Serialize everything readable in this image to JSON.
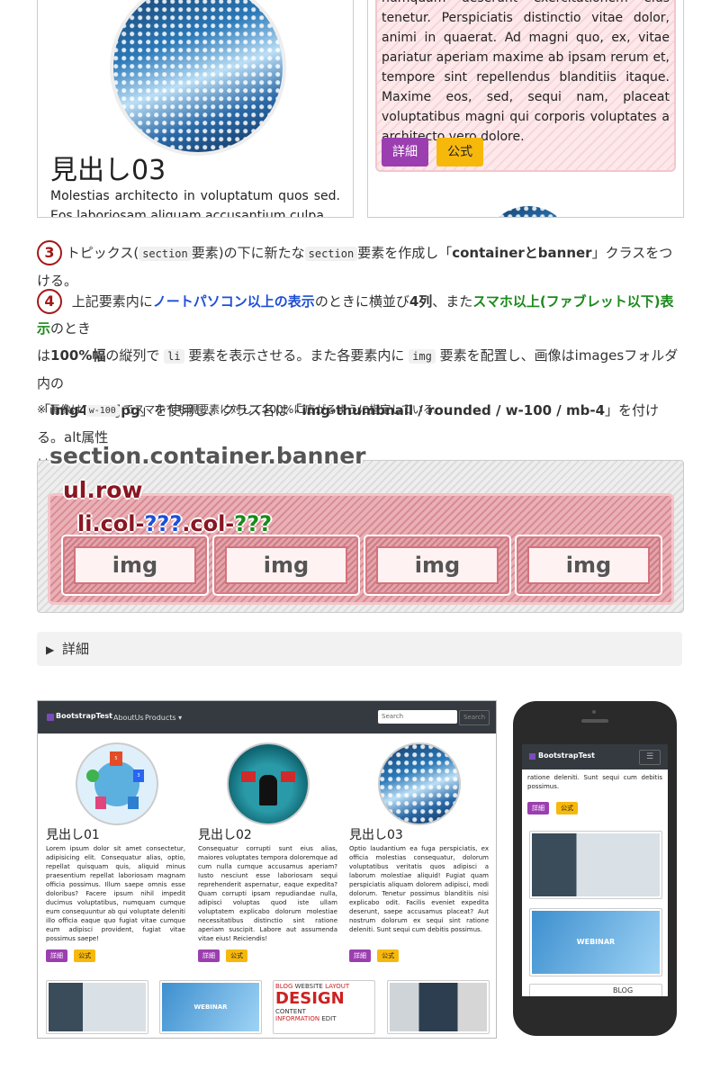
{
  "top_cards": {
    "left": {
      "heading": "見出し03",
      "text": "Molestias architecto in voluptatum quos sed. Eos laboriosam aliquam accusantium culpa"
    },
    "right": {
      "text": "numquam deserunt exercitationem eius tenetur. Perspiciatis distinctio vitae dolor, animi in quaerat. Ad magni quo, ex, vitae pariatur aperiam maxime ab ipsam rerum et, tempore sint repellendus blanditiis itaque. Maxime eos, sed, sequi nam, placeat voluptatibus magni qui corporis voluptates a architecto vero dolore.",
      "btn_detail": "詳細",
      "btn_official": "公式"
    }
  },
  "step3": {
    "num": "3",
    "t1": "トピックス(",
    "code1": "section",
    "t2": "要素)の下に新たな",
    "code2": "section",
    "t3": "要素を作成し「",
    "b1": "containerとbanner",
    "t4": "」クラスをつける。"
  },
  "step4": {
    "num": "4",
    "t1": "上記要素内に",
    "blue1": "ノートパソコン以上の表示",
    "t2": "のときに横並び",
    "b1": "4列",
    "t3": "、また",
    "green1": "スマホ以上(ファブレット以下)表示",
    "t4": "のとき",
    "t5": "は",
    "b2": "100%幅",
    "t6": "の縦列で",
    "code1": "li",
    "t7": "要素を表示させる。また各要素内に",
    "code2": "img",
    "t8": "要素を配置し、画像はimagesフォルダ内の",
    "t9": "「",
    "b3": "img4〜7.jpg",
    "t10": "」を使用し、クラス名は「",
    "b4": "img-thumbnail / rounded / w-100 / mb-4",
    "t11": "」を付ける。alt属性",
    "t12": "は「",
    "b5": "バナー",
    "t13": "」にする。",
    "note_a": "※ 画像は",
    "note_code": "w-100",
    "note_b": "でスマホでも親要素に対して100%に広がるように指定している。"
  },
  "diagram": {
    "section_label": "section.container.banner",
    "row_label": "ul.row",
    "col_label_a": "li.col-",
    "col_q1": "???",
    "col_label_b": ".col-",
    "col_q2": "???",
    "img_labels": [
      "img",
      "img",
      "img",
      "img"
    ]
  },
  "details": {
    "label": "詳細"
  },
  "mock": {
    "brand": "BootstrapTest",
    "nav_about": "AboutUs",
    "nav_products": "Products",
    "search_placeholder": "Search",
    "search_btn": "Search",
    "cols": [
      {
        "heading": "見出し01",
        "text": "Lorem ipsum dolor sit amet consectetur, adipisicing elit. Consequatur alias, optio, repellat quisquam quis, aliquid minus praesentium repellat laboriosam magnam officia possimus. Illum saepe omnis esse doloribus? Facere ipsum nihil impedit ducimus voluptatibus, numquam cumque eum consequuntur ab qui voluptate deleniti illo officia eaque quo fugiat vitae cumque eum adipisci provident, fugiat vitae possimus saepe!"
      },
      {
        "heading": "見出し02",
        "text": "Consequatur corrupti sunt eius alias, maiores voluptates tempora doloremque ad cum nulla cumque accusamus aperiam? Iusto nesciunt esse laboriosam sequi reprehenderit aspernatur, eaque expedita? Quam corrupti ipsam repudiandae nulla, adipisci voluptas quod iste ullam voluptatem explicabo dolorum molestiae necessitatibus distinctio sint ratione aperiam suscipit. Labore aut assumenda vitae eius! Reiciendis!"
      },
      {
        "heading": "見出し03",
        "text": "Optio laudantium ea fuga perspiciatis, ex officia molestias consequatur, dolorum voluptatibus veritatis quos adipisci a laborum molestiae aliquid! Fugiat quam perspiciatis aliquam dolorem adipisci, modi dolorum. Tenetur possimus blanditiis nisi explicabo odit. Facilis eveniet expedita deserunt, saepe accusamus placeat? Aut nostrum dolorum ex sequi sint ratione deleniti. Sunt sequi cum debitis possimus."
      }
    ],
    "btn_detail": "詳細",
    "btn_official": "公式",
    "icons": {
      "html5": "HTML5",
      "css3": "CSS3",
      "php": "PHP5",
      "js": "JS"
    },
    "banner_webinar": "WEBINAR",
    "banner_words": [
      "DESIGN",
      "WEBSITE",
      "BLOG",
      "CONTENT",
      "LAYOUT",
      "INFORMATION",
      "EDIT"
    ],
    "phone": {
      "brand": "BootstrapTest",
      "text": "ratione deleniti. Sunt sequi cum debitis possimus.",
      "btn_detail": "詳細",
      "btn_official": "公式",
      "webinar": "WEBINAR",
      "blog": "BLOG"
    }
  }
}
